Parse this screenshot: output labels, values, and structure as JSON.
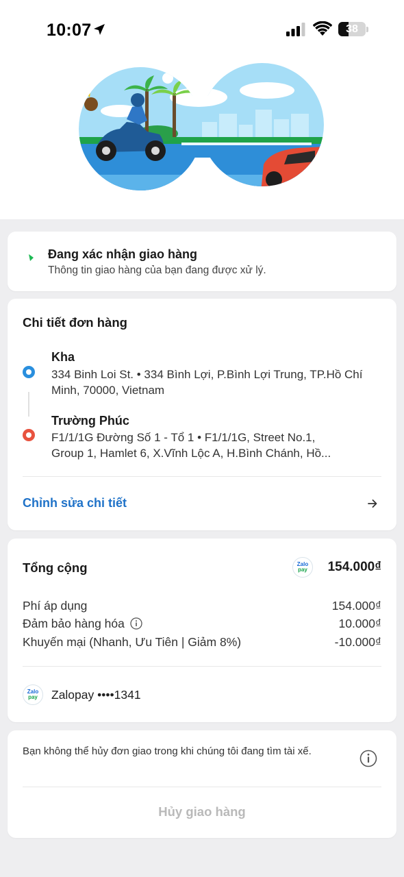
{
  "status_bar": {
    "time": "10:07",
    "battery": "38",
    "battery_level": 0.38,
    "icons": [
      "location-arrow-icon",
      "signal-icon",
      "wifi-icon",
      "battery-icon"
    ]
  },
  "status_card": {
    "title": "Đang xác nhận giao hàng",
    "subtitle": "Thông tin giao hàng của bạn đang được xử lý."
  },
  "order_details": {
    "title": "Chi tiết đơn hàng",
    "pickup": {
      "name": "Kha",
      "address": "334 Binh Loi St. • 334 Bình Lợi, P.Bình Lợi Trung, TP.Hồ Chí Minh, 70000, Vietnam"
    },
    "dropoff": {
      "name": "Trường Phúc",
      "address_line1": "F1/1/1G Đường Số 1 - Tổ 1 • F1/1/1G, Street No.1,",
      "address_line2": "Group 1, Hamlet 6, X.Vĩnh Lộc A, H.Bình Chánh, Hồ..."
    },
    "edit_label": "Chỉnh sửa chi tiết"
  },
  "total": {
    "title": "Tổng cộng",
    "amount": "154.000₫",
    "logo_text_top": "Zalo",
    "logo_text_bottom": "pay",
    "fees": [
      {
        "label": "Phí áp dụng",
        "value": "154.000₫"
      },
      {
        "label": "Đảm bảo hàng hóa",
        "value": "10.000₫"
      },
      {
        "label": "Khuyến mại (Nhanh, Ưu Tiên | Giảm 8%)",
        "value": "-10.000₫"
      }
    ],
    "payment_method": "Zalopay ••••1341"
  },
  "cancel": {
    "notice": "Bạn không thể hủy đơn giao trong khi chúng tôi đang tìm tài xế.",
    "button": "Hủy giao hàng"
  },
  "colors": {
    "accent_blue": "#1f72c8",
    "pickup_dot": "#2a8fde",
    "dropoff_dot": "#e8533f",
    "status_green": "#1db954",
    "disabled_text": "#b9b9b9"
  }
}
